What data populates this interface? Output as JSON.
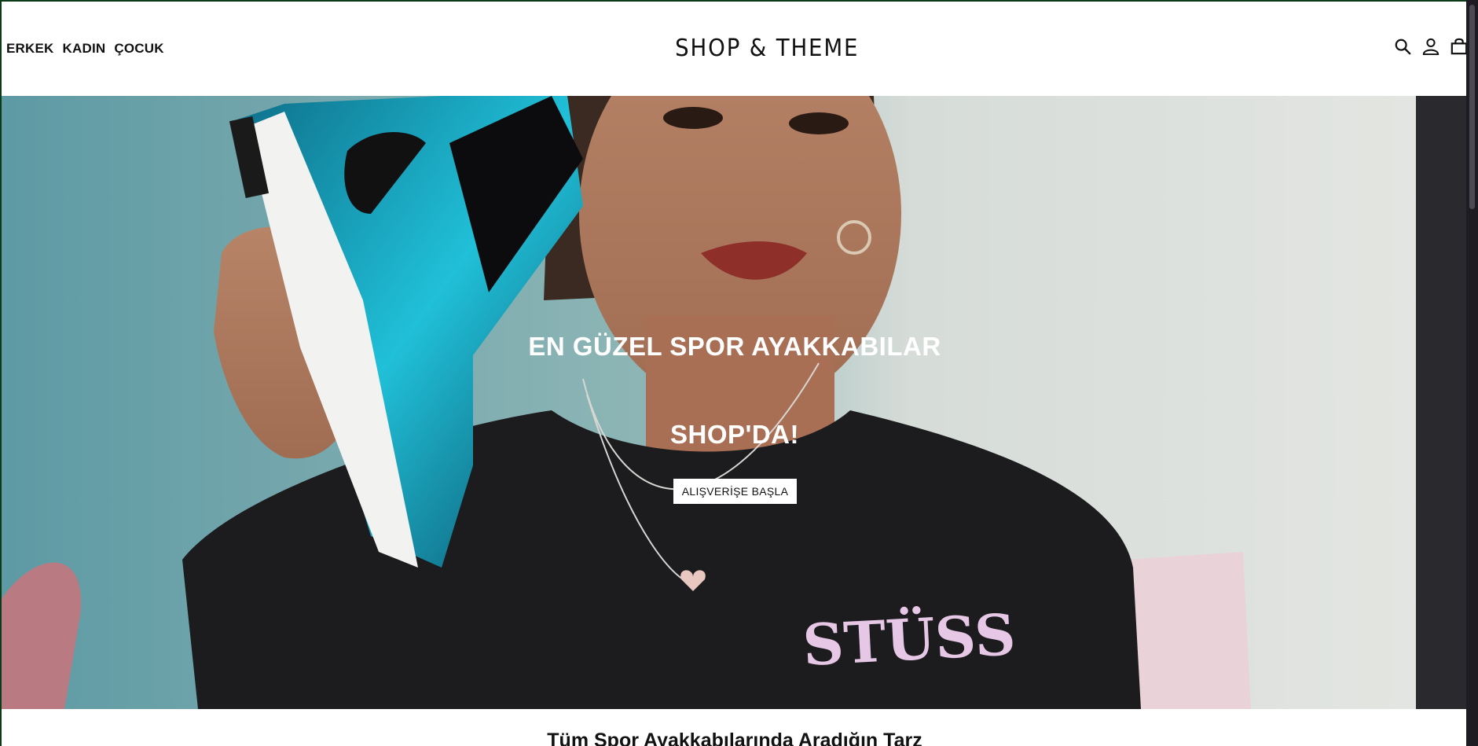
{
  "header": {
    "nav": [
      "ERKEK",
      "KADIN",
      "ÇOCUK"
    ],
    "logo": "SHOP & THEME",
    "icons": [
      "search-icon",
      "account-icon",
      "cart-icon"
    ]
  },
  "hero": {
    "title_line1": "EN GÜZEL SPOR AYAKKABILAR",
    "title_line2": "SHOP'DA!",
    "cta_label": "ALIŞVERİŞE BAŞLA",
    "shirt_print": "STÜSS"
  },
  "section": {
    "title": "Tüm Spor Ayakkabılarında Aradığın Tarz"
  },
  "colors": {
    "text": "#111111",
    "hero_wall_left": "#5e9aa4",
    "hero_wall_right": "#dfe3df",
    "sneaker_blue": "#1ab3cf",
    "shirt": "#1a1a1a"
  }
}
